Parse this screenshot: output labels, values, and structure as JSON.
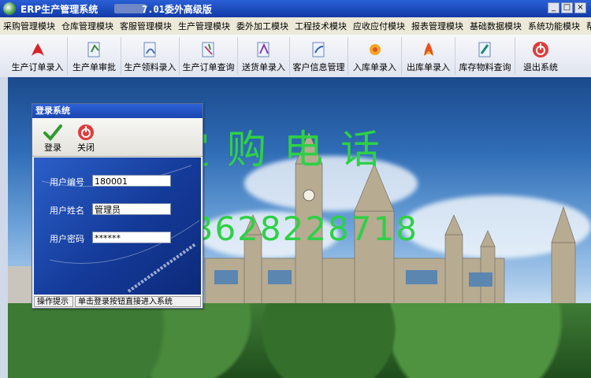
{
  "window": {
    "title": "ERP生产管理系统",
    "version": "7.01委外高级版",
    "controls": [
      "_",
      "□",
      "×"
    ]
  },
  "menu": [
    "采购管理模块",
    "仓库管理模块",
    "客服管理模块",
    "生产管理模块",
    "委外加工模块",
    "工程技术模块",
    "应收应付模块",
    "报表管理模块",
    "基础数据模块",
    "系统功能模块",
    "帮助"
  ],
  "toolbar": [
    {
      "label": "生产订单录入",
      "icon": "pdf-icon"
    },
    {
      "label": "生产单审批",
      "icon": "approve-icon"
    },
    {
      "label": "生产领料录入",
      "icon": "material-icon"
    },
    {
      "label": "生产订单查询",
      "icon": "query-icon"
    },
    {
      "label": "送货单录入",
      "icon": "delivery-icon"
    },
    {
      "label": "客户信息管理",
      "icon": "customer-icon"
    },
    {
      "label": "入库单录入",
      "icon": "stock-in-icon"
    },
    {
      "label": "出库单录入",
      "icon": "stock-out-icon"
    },
    {
      "label": "库存物料查询",
      "icon": "inventory-icon"
    },
    {
      "label": "退出系统",
      "icon": "exit-icon"
    }
  ],
  "overlay": {
    "line1": "定购电话",
    "line2": "13628228718",
    "color": "#2fd046"
  },
  "login": {
    "title": "登录系统",
    "login_button": "登录",
    "close_button": "关闭",
    "user_id_label": "用户编号",
    "user_id_value": "180001",
    "user_name_label": "用户姓名",
    "user_name_value": "管理员",
    "password_label": "用户密码",
    "password_value": "******",
    "status_label": "操作提示",
    "status_text": "单击登录按钮直接进入系统"
  }
}
